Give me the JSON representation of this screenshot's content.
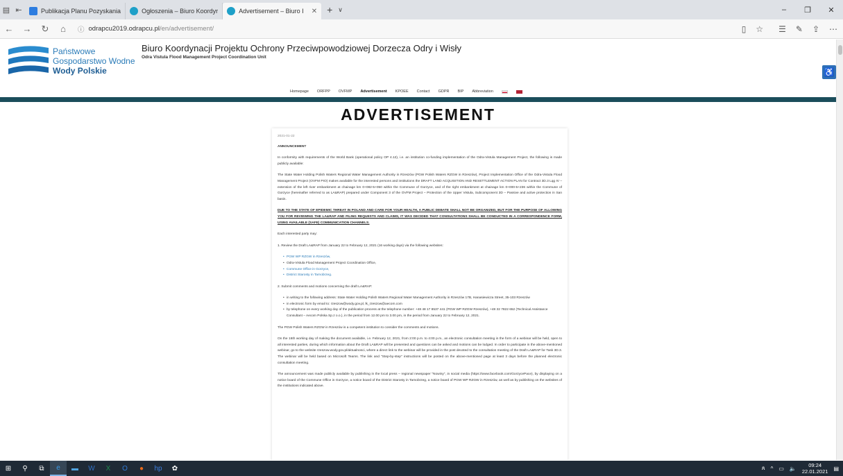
{
  "browser": {
    "tabs": [
      {
        "label": "Publikacja Planu Pozyskania",
        "active": false,
        "color": "#2d7de0"
      },
      {
        "label": "Ogłoszenia – Biuro Koordyr",
        "active": false,
        "color": "#1ea0c8"
      },
      {
        "label": "Advertisement – Biuro I",
        "active": true,
        "color": "#1ea0c8"
      }
    ],
    "url_host": "odrapcu2019.odrapcu.pl",
    "url_path": "/en/advertisement/"
  },
  "site": {
    "logo_line1": "Państwowe",
    "logo_line2": "Gospodarstwo Wodne",
    "logo_line3": "Wody Polskie",
    "header_title": "Biuro Koordynacji Projektu Ochrony Przeciwpowodziowej Dorzecza Odry i Wisły",
    "header_sub": "Odra Vistula Flood Management Project Coordination Unit",
    "brand_color": "#1b4d5b"
  },
  "menu": {
    "items": [
      "Homepage",
      "ORFPP",
      "OVFMP",
      "Advertisement",
      "KPOEE",
      "Contact",
      "GDPR",
      "BIP",
      "Abbreviation"
    ]
  },
  "article": {
    "title": "ADVERTISEMENT",
    "date": "2021-01-22",
    "heading": "ANNOUNCEMENT",
    "p1": "In conformity with requirements of the World Bank (operational policy OP 4.12), i.e. an institution co-funding implementation of the Odra-Vistula Management Project, the following is made publicly available:",
    "p2": "The State Water Holding Polish Waters Regional Water Management Authority in Rzeszów (PGW Polish Waters RZGW in Rzeszów), Project Implementation Office of the Odra-Vistula Flood Management Project (OVFM PIO) makes available for the interested persons and institutions the DRAFT LAND ACQUISITION AND RESETTLEMENT ACTION PLAN for Contract 3D.3 Lqg IV – extension of the left river embankment at chainage km 0+082-5+050 within the Commune of Gorzyce, and of the right embankment at chainage km 0+000-5+236 within the Commune of Gorzyce (hereinafter referred to as LA&RAP) prepared under Component 3 of the OVFM Project – Protection of the Upper Vistula, Subcomponent 3D – Passive and active protection in San basin.",
    "p3": "DUE TO THE STATE OF EPIDEMIC THREAT IN POLAND AND CARE FOR YOUR HEALTH, A PUBLIC DEBATE SHALL NOT BE ORGANIZED, BUT FOR THE PURPOSE OF ALLOWING YOU FOR REVIEWING THE LA&RAP AND FILING REQUESTS AND CLAIMS, IT WAS DECIDED THAT CONSULTATIONS SHALL BE CONDUCTED IN A CORRESPONDENCE FORM, USING AVAILABLE (SAFE) COMMUNICATION CHANNELS.",
    "p4": "Each interested party may:",
    "p5": "1. Review the Draft LA&RAP from January 22 to February 12, 2021 (16 working days) via the following websites:",
    "list1": [
      "PGW WP RZGW in Rzeszów,",
      "Odra-Vistula Flood Management Project Coordination Office,",
      "Commune Office in Gorzyce,",
      "District Starosty in Tarnobrzeg."
    ],
    "p6": "2. Submit comments and motions concerning the draft LA&RAP:",
    "list2": [
      "in writing to the following address: State Water Holding Polish Waters Regional Water Management Authority in Rzeszów 17B, Hanasiewicza Street, 35-103 Rzeszów",
      "in electronic form by email to: rzeszow@wody.gov.pl, lk_rzeszow@aecom.com",
      "by telephone on every working day of the publication process at the telephone number: +48 48 17 8537 441 (PGW WP RZGW Rzeszów), +48 32 7822 652 (Technical Assistance Consultant – Aecom Polska Sp.z o.o.), in the period from 12.00 pm to 3.00 pm, in the period from January 22 to February 12, 2021."
    ],
    "p7": "The PGW Polish Waters RZGW in Rzeszów is a competent institution to consider the comments and motions.",
    "p8": "On the 16th working day of making the document available, i.e. February 12, 2021, from 2:00 p.m. to 4:00 p.m., an electronic consultation meeting in the form of a webinar will be held, open to all interested parties, during which information about the Draft LA&RAP will be presented and questions can be asked and motions can be lodged. In order to participate in the above-mentioned webinar, go to the website rzeszow.wody.gov.pl/aktualnosci, where a direct link to the webinar will be provided in the post devoted to the consultation meeting of the Draft LA&RAP for Task 3D.3. The webinar will be held based on Microsoft Teams. The link and \"Step-by-step\" instructions will be posted on the above-mentioned page at least 3 days before the planned electronic consultation meeting.",
    "p9": "The announcement was made publicly available by publishing in the local press – regional newspaper \"Nowiny\", in social media (https://www.facebook.com/GorzycePace), by displaying on a notice board of the Commune Office in Gorzyce, a notice board of the District Starosty in Tarnobrzeg, a notice board of PGW WP RZGW in Rzeszów, as well as by publishing on the websites of the institutions indicated above."
  },
  "taskbar": {
    "time": "09:24",
    "date": "22.01.2021"
  }
}
